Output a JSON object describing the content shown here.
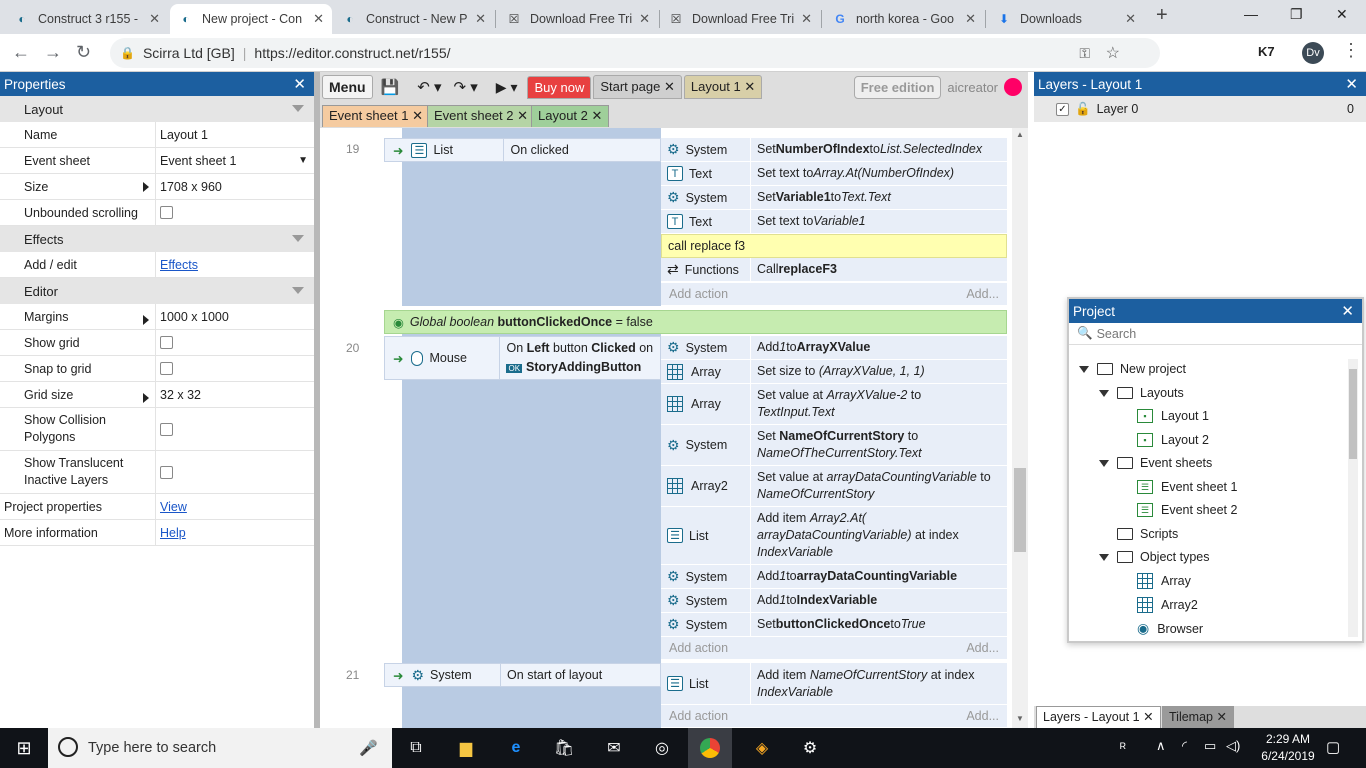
{
  "browser": {
    "tabs": [
      {
        "title": "Construct 3 r155 -",
        "icon": "construct-icon"
      },
      {
        "title": "New project - Con",
        "icon": "construct-icon"
      },
      {
        "title": "Construct - New P",
        "icon": "construct-icon"
      },
      {
        "title": "Download Free Tri",
        "icon": "x-icon"
      },
      {
        "title": "Download Free Tri",
        "icon": "x-icon"
      },
      {
        "title": "north korea - Goo",
        "icon": "google-icon"
      },
      {
        "title": "Downloads",
        "icon": "download-icon"
      }
    ],
    "new_tab": "+",
    "site_name": "Scirra Ltd [GB]",
    "url": "https://editor.construct.net/r155/",
    "profile": "Dv",
    "ext": "K7"
  },
  "properties": {
    "title": "Properties",
    "sections": {
      "layout": "Layout",
      "effects": "Effects",
      "editor": "Editor"
    },
    "rows": {
      "name": {
        "k": "Name",
        "v": "Layout 1"
      },
      "event_sheet": {
        "k": "Event sheet",
        "v": "Event sheet 1"
      },
      "size": {
        "k": "Size",
        "v": "1708 x 960"
      },
      "unbounded": {
        "k": "Unbounded scrolling"
      },
      "addedit": {
        "k": "Add / edit",
        "v": "Effects"
      },
      "margins": {
        "k": "Margins",
        "v": "1000 x 1000"
      },
      "showgrid": {
        "k": "Show grid"
      },
      "snap": {
        "k": "Snap to grid"
      },
      "gridsize": {
        "k": "Grid size",
        "v": "32 x 32"
      },
      "collision": {
        "k": "Show Collision Polygons"
      },
      "translucent": {
        "k": "Show Translucent Inactive Layers"
      },
      "projprops": {
        "k": "Project properties",
        "v": "View"
      },
      "moreinfo": {
        "k": "More information",
        "v": "Help"
      }
    }
  },
  "toolbar": {
    "menu": "Menu",
    "buy": "Buy now",
    "start": "Start page",
    "layout1": "Layout 1",
    "free": "Free edition",
    "user": "aicreator"
  },
  "sheet_tabs": [
    "Event sheet 1",
    "Event sheet 2",
    "Layout 2"
  ],
  "events": {
    "e19": {
      "num": "19",
      "obj": "List",
      "cond": "On clicked",
      "actions": [
        {
          "obj": "System",
          "pre": "Set ",
          "b1": "NumberOfIndex",
          "mid": " to ",
          "i1": "List.SelectedIndex"
        },
        {
          "obj": "Text",
          "pre": "Set text to ",
          "i1": "Array.At(NumberOfIndex)"
        },
        {
          "obj": "System",
          "pre": "Set ",
          "b1": "Variable1",
          "mid": " to ",
          "i1": "Text.Text"
        },
        {
          "obj": "Text",
          "pre": "Set text to ",
          "i1": "Variable1"
        }
      ],
      "comment": "call replace f3",
      "func": {
        "obj": "Functions",
        "pre": "Call ",
        "b1": "replaceF3"
      }
    },
    "global": {
      "pre": "Global boolean ",
      "b": "buttonClickedOnce",
      "post": " = false"
    },
    "e20": {
      "num": "20",
      "obj": "Mouse",
      "cond_pre": "On ",
      "cond_b1": "Left",
      "cond_mid": " button ",
      "cond_b2": "Clicked",
      "cond_post": " on",
      "cond_target": "StoryAddingButton",
      "actions": [
        {
          "obj": "System",
          "pre": "Add ",
          "i1": "1",
          "mid": " to ",
          "b1": "ArrayXValue"
        },
        {
          "obj": "Array",
          "pre": "Set size to ",
          "i1": "(ArrayXValue, 1, 1)"
        },
        {
          "obj": "Array",
          "pre": "Set value at ",
          "i1": "ArrayXValue-2",
          "mid": " to ",
          "i2": "TextInput.Text"
        },
        {
          "obj": "System",
          "pre": "Set ",
          "b1": "NameOfCurrentStory",
          "mid": " to ",
          "i1": "NameOfTheCurrentStory.Text"
        },
        {
          "obj": "Array2",
          "pre": "Set value at ",
          "i1": "arrayDataCountingVariable",
          "mid": " to ",
          "i2": "NameOfCurrentStory"
        },
        {
          "obj": "List",
          "pre": "Add item ",
          "i1": "Array2.At( arrayDataCountingVariable)",
          "mid": " at index ",
          "i2": "IndexVariable"
        },
        {
          "obj": "System",
          "pre": "Add ",
          "i1": "1",
          "mid": " to ",
          "b1": "arrayDataCountingVariable"
        },
        {
          "obj": "System",
          "pre": "Add ",
          "i1": "1",
          "mid": " to ",
          "b1": "IndexVariable"
        },
        {
          "obj": "System",
          "pre": "Set ",
          "b1": "buttonClickedOnce",
          "mid": " to ",
          "i1": "True"
        }
      ]
    },
    "e21": {
      "num": "21",
      "obj": "System",
      "cond": "On start of layout",
      "actions": [
        {
          "obj": "List",
          "pre": "Add item ",
          "i1": "NameOfCurrentStory",
          "mid": " at index ",
          "i2": "IndexVariable"
        }
      ]
    },
    "add_action": "Add action",
    "add_short": "Add..."
  },
  "layers": {
    "title": "Layers - Layout 1",
    "layer": "Layer 0",
    "count": "0",
    "tab1": "Layers - Layout 1",
    "tab2": "Tilemap"
  },
  "project": {
    "title": "Project",
    "search": "Search",
    "tree": {
      "root": "New project",
      "layouts": "Layouts",
      "l1": "Layout 1",
      "l2": "Layout 2",
      "sheets": "Event sheets",
      "s1": "Event sheet 1",
      "s2": "Event sheet 2",
      "scripts": "Scripts",
      "objtypes": "Object types",
      "o1": "Array",
      "o2": "Array2",
      "o3": "Browser"
    }
  },
  "taskbar": {
    "search": "Type here to search",
    "time": "2:29 AM",
    "date": "6/24/2019"
  }
}
